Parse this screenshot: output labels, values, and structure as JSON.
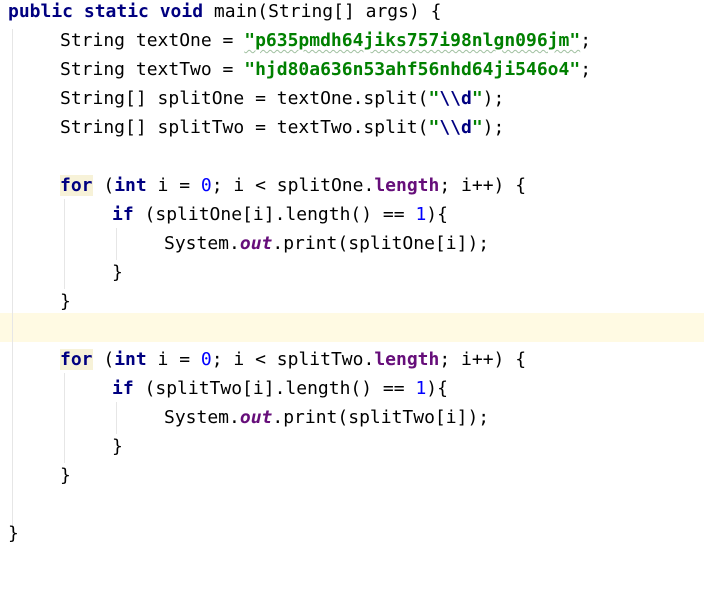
{
  "lines": [
    {
      "t1": "public static void",
      "t2": " main(String[] args) {"
    },
    {
      "t1": "String textOne = ",
      "t2": "\"p635pmdh64jiks757i98nlgn096jm\"",
      "t3": ";"
    },
    {
      "t1": "String textTwo = ",
      "t2": "\"hjd80a636n53ahf56nhd64ji546o4\"",
      "t3": ";"
    },
    {
      "t1": "String[] splitOne = textOne.split(",
      "t2": "\"",
      "t3": "\\\\d",
      "t4": "\"",
      "t5": ");"
    },
    {
      "t1": "String[] splitTwo = textTwo.split(",
      "t2": "\"",
      "t3": "\\\\d",
      "t4": "\"",
      "t5": ");"
    },
    {},
    {
      "t1": "for",
      "t2": " (",
      "t3": "int",
      "t4": " i = ",
      "t5": "0",
      "t6": "; i < splitOne.",
      "t7": "length",
      "t8": "; i++) {"
    },
    {
      "t1": "if",
      "t2": " (splitOne[i].length() == ",
      "t3": "1",
      "t4": "){"
    },
    {
      "t1": "System.",
      "t2": "out",
      "t3": ".print(splitOne[i]);"
    },
    {
      "t1": "}"
    },
    {
      "t1": "}"
    },
    {},
    {
      "t1": "for",
      "t2": " (",
      "t3": "int",
      "t4": " i = ",
      "t5": "0",
      "t6": "; i < splitTwo.",
      "t7": "length",
      "t8": "; i++) {"
    },
    {
      "t1": "if",
      "t2": " (splitTwo[i].length() == ",
      "t3": "1",
      "t4": "){"
    },
    {
      "t1": "System.",
      "t2": "out",
      "t3": ".print(splitTwo[i]);"
    },
    {
      "t1": "}"
    },
    {
      "t1": "}"
    },
    {},
    {
      "t1": "}"
    }
  ]
}
